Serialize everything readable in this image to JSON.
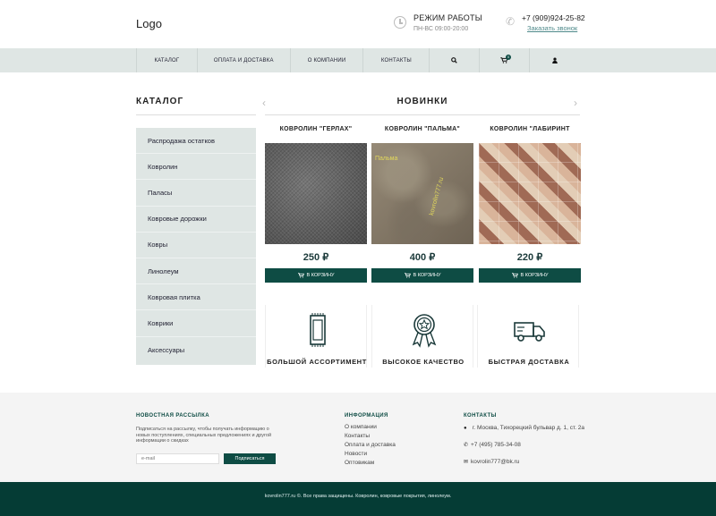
{
  "header": {
    "logo": "Logo",
    "hours_title": "РЕЖИМ РАБОТЫ",
    "hours_time": "ПН-ВС 09:00-20:00",
    "phone": "+7 (909)924-25-82",
    "callback": "Заказать звонок"
  },
  "nav": {
    "items": [
      "КАТАЛОГ",
      "ОПЛАТА И ДОСТАВКА",
      "О КОМПАНИИ",
      "КОНТАКТЫ"
    ],
    "cart_count": "0"
  },
  "sidebar": {
    "title": "КАТАЛОГ",
    "items": [
      "Распродажа остатков",
      "Ковролин",
      "Паласы",
      "Ковровые дорожки",
      "Ковры",
      "Линолеум",
      "Ковровая плитка",
      "Коврики",
      "Аксессуары"
    ]
  },
  "new": {
    "title": "НОВИНКИ",
    "products": [
      {
        "name": "КОВРОЛИН \"ГЕРЛАХ\"",
        "price": "250 ₽",
        "button": "В КОРЗИНУ"
      },
      {
        "name": "КОВРОЛИН \"ПАЛЬМА\"",
        "price": "400 ₽",
        "button": "В КОРЗИНУ"
      },
      {
        "name": "КОВРОЛИН \"ЛАБИРИНТ",
        "price": "220 ₽",
        "button": "В КОРЗИНУ"
      }
    ],
    "watermark1": "Пальма",
    "watermark2": "kovrolin777.ru"
  },
  "features": [
    "БОЛЬШОЙ АССОРТИМЕНТ",
    "ВЫСОКОЕ КАЧЕСТВО",
    "БЫСТРАЯ ДОСТАВКА"
  ],
  "footer": {
    "newsletter_title": "НОВОСТНАЯ РАССЫЛКА",
    "newsletter_text_1": "Подписаться на рассылку, чтобы получать информацию о",
    "newsletter_text_2": "новых поступлениях, специальных предложениях и другой",
    "newsletter_text_3": "информации о скидках",
    "email_placeholder": "e-mail",
    "subscribe": "Подписаться",
    "info_title": "ИНФОРМАЦИЯ",
    "info_links": [
      "О компании",
      "Контакты",
      "Оплата и доставка",
      "Новости",
      "Оптовикам"
    ],
    "contacts_title": "КОНТАКТЫ",
    "address": "г. Москва, Тихорецкий бульвар д. 1, ст. 2а",
    "phone": "+7 (495) 785-34-08",
    "email": "kovrolin777@bk.ru",
    "copyright": "kovrolin777.ru ©. Все права защищены. Ковролин, ковровые покрытия, линолеум."
  },
  "colors": {
    "accent": "#0e4c44",
    "nav_bg": "#dfe6e4",
    "footer_bg": "#053c35"
  }
}
